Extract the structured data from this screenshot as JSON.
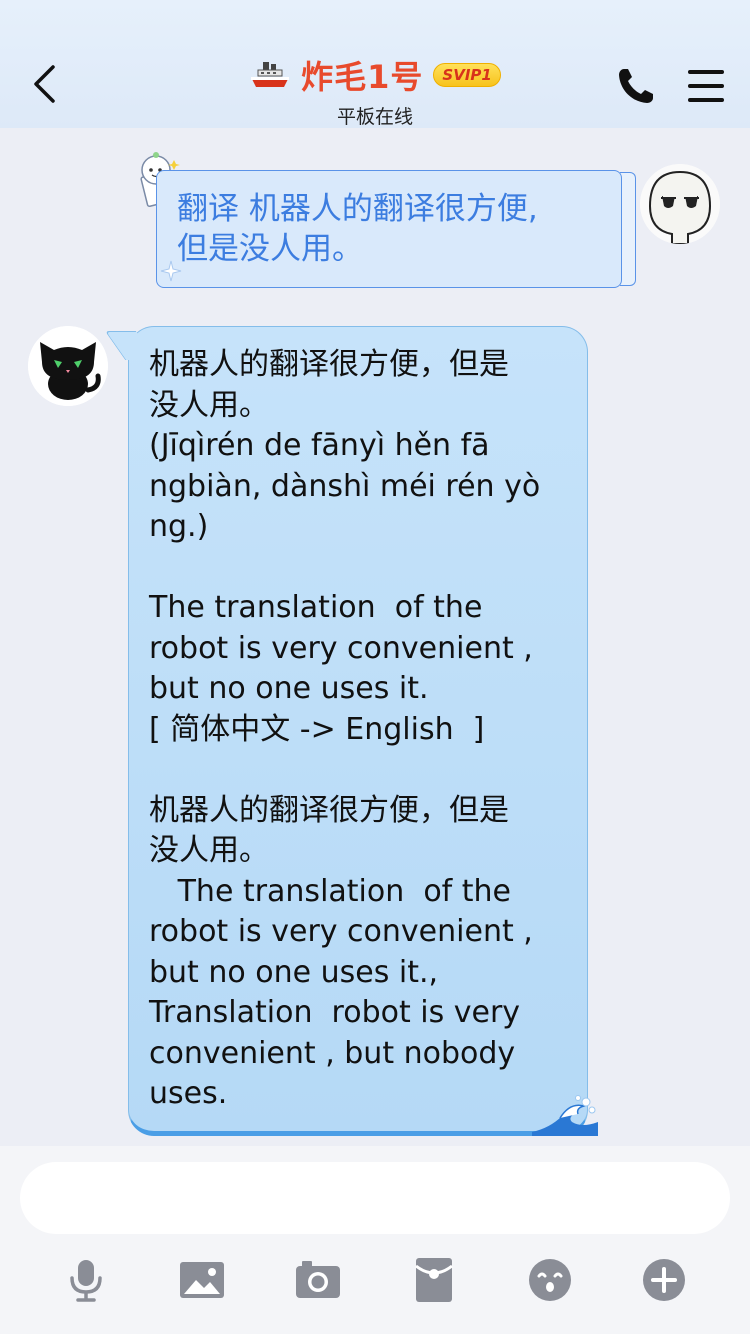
{
  "header": {
    "title": "炸毛1号",
    "badge": "SVIP1",
    "subtitle": "平板在线",
    "icons": {
      "back": "chevron-left-icon",
      "title_decoration": "ship-icon",
      "call": "phone-icon",
      "menu": "menu-icon"
    }
  },
  "messages": [
    {
      "sender": "me",
      "text": "翻译 机器人的翻译很方便,\n但是没人用。"
    },
    {
      "sender": "bot",
      "text": "机器人的翻译很方便，但是\n没人用。\n(Jīqìrén de fānyì hěn fā\nngbiàn, dànshì méi rén yò\nng.)\n\nThe translation  of the\nrobot is very convenient ,\nbut no one uses it.\n[ 简体中文 -> English  ]\n\n机器人的翻译很方便，但是\n没人用。\n   The translation  of the\nrobot is very convenient ,\nbut no one uses it.,\nTranslation  robot is very\nconvenient , but nobody\nuses."
    }
  ],
  "input": {
    "value": "",
    "placeholder": ""
  },
  "toolbar": {
    "icons": [
      "microphone-icon",
      "image-icon",
      "camera-icon",
      "red-packet-icon",
      "emoji-icon",
      "plus-icon"
    ]
  },
  "colors": {
    "accent_blue": "#3c7de0",
    "title_red": "#e84a2c",
    "bot_bubble": "#c6e3fa",
    "icon_gray": "#8a8d96"
  }
}
